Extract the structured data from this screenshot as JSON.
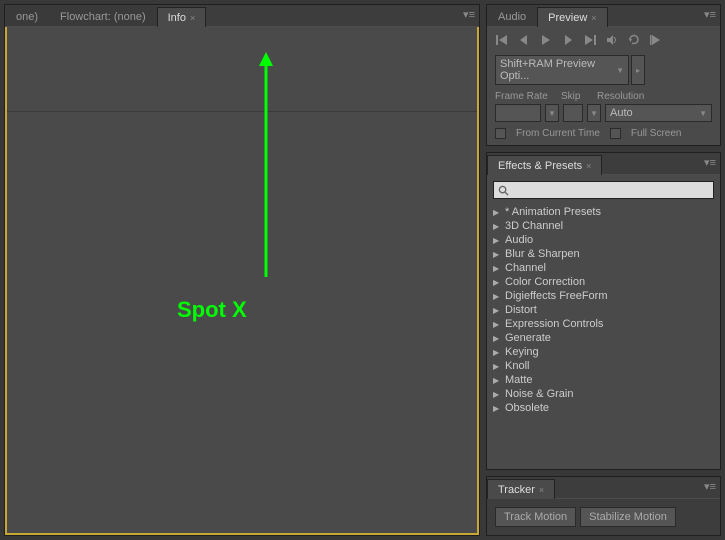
{
  "left": {
    "tabs": [
      {
        "label": "one)",
        "active": false,
        "closable": false
      },
      {
        "label": "Flowchart: (none)",
        "active": false,
        "closable": false
      },
      {
        "label": "Info",
        "active": true,
        "closable": true
      }
    ],
    "annotation": "Spot X"
  },
  "preview": {
    "tabs": [
      {
        "label": "Audio",
        "active": false
      },
      {
        "label": "Preview",
        "active": true
      }
    ],
    "dropdown": "Shift+RAM Preview Opti...",
    "labels": {
      "frameRate": "Frame Rate",
      "skip": "Skip",
      "resolution": "Resolution"
    },
    "resolutionValue": "Auto",
    "fromCurrent": "From Current Time",
    "fullScreen": "Full Screen"
  },
  "effects": {
    "title": "Effects & Presets",
    "searchPlaceholder": "",
    "items": [
      "* Animation Presets",
      "3D Channel",
      "Audio",
      "Blur & Sharpen",
      "Channel",
      "Color Correction",
      "Digieffects FreeForm",
      "Distort",
      "Expression Controls",
      "Generate",
      "Keying",
      "Knoll",
      "Matte",
      "Noise & Grain",
      "Obsolete"
    ]
  },
  "tracker": {
    "title": "Tracker",
    "trackMotion": "Track Motion",
    "stabilizeMotion": "Stabilize Motion"
  }
}
